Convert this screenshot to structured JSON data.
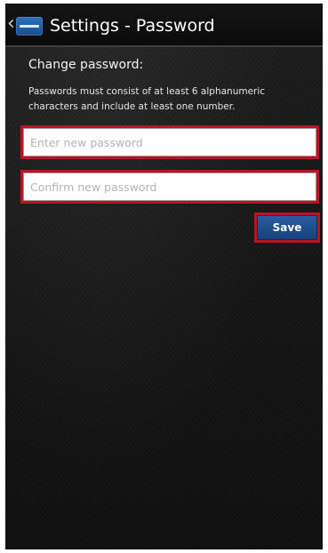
{
  "header": {
    "title": "Settings - Password",
    "back_icon": "chevron-left-icon",
    "app_icon": "app-logo-icon"
  },
  "content": {
    "heading": "Change password:",
    "help_text": "Passwords must consist of at least 6 alphanumeric characters and include at least one number."
  },
  "form": {
    "new_password": {
      "placeholder": "Enter new password",
      "value": ""
    },
    "confirm_password": {
      "placeholder": "Confirm new password",
      "value": ""
    },
    "save_label": "Save"
  },
  "colors": {
    "highlight": "#b9141f",
    "button": "#1f4d8c",
    "background": "#161616"
  }
}
